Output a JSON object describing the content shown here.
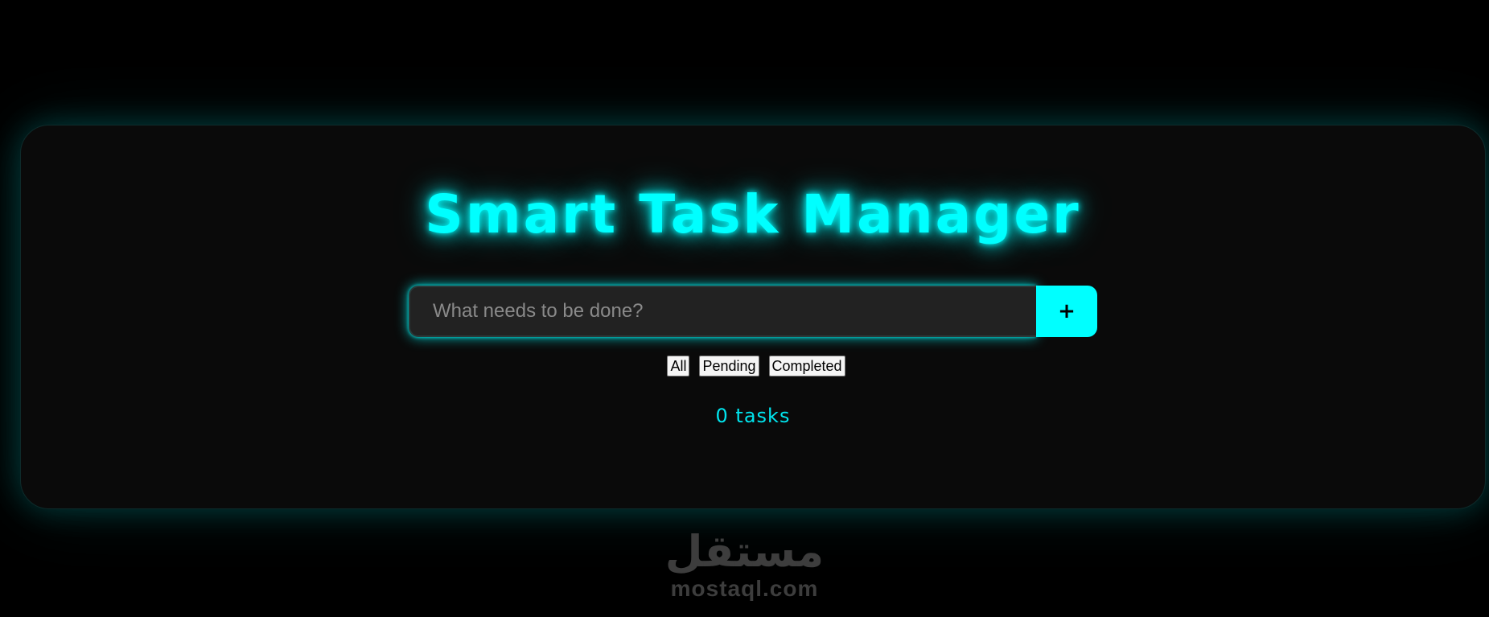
{
  "app": {
    "title": "Smart Task Manager"
  },
  "input": {
    "placeholder": "What needs to be done?",
    "value": ""
  },
  "add_button": {
    "label": "+"
  },
  "filters": [
    {
      "label": "All"
    },
    {
      "label": "Pending"
    },
    {
      "label": "Completed"
    }
  ],
  "task_count": {
    "text": "0 tasks"
  },
  "watermark": {
    "arabic": "مستقل",
    "latin": "mostaql.com"
  },
  "colors": {
    "accent": "#00ffff",
    "background": "#000000",
    "card": "#0a0a0a",
    "input_bg": "#222222"
  }
}
